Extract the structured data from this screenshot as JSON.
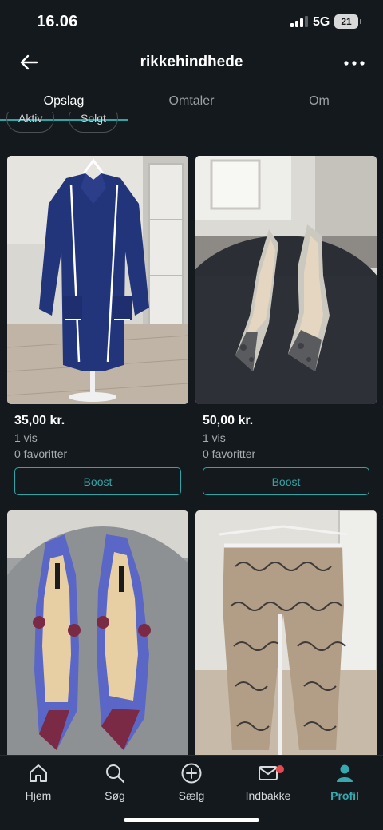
{
  "status_bar": {
    "time": "16.06",
    "network": "5G",
    "battery": "21"
  },
  "header": {
    "title": "rikkehindhede",
    "back_icon": "arrow-left-icon",
    "more_icon": "more-horizontal-icon"
  },
  "tabs": [
    {
      "label": "Opslag",
      "active": true
    },
    {
      "label": "Omtaler",
      "active": false
    },
    {
      "label": "Om",
      "active": false
    }
  ],
  "filters": [
    {
      "label": "Aktiv"
    },
    {
      "label": "Solgt"
    }
  ],
  "items": [
    {
      "price": "35,00 kr.",
      "views": "1 vis",
      "favorites": "0 favoritter",
      "boost_label": "Boost",
      "image": "blue-robe-photo"
    },
    {
      "price": "50,00 kr.",
      "views": "1 vis",
      "favorites": "0 favoritter",
      "boost_label": "Boost",
      "image": "snakeskin-heels-photo"
    },
    {
      "image": "floral-heels-photo"
    },
    {
      "image": "lace-pants-photo"
    }
  ],
  "bottom_nav": [
    {
      "label": "Hjem",
      "icon": "home-icon",
      "active": false
    },
    {
      "label": "Søg",
      "icon": "search-icon",
      "active": false
    },
    {
      "label": "Sælg",
      "icon": "plus-circle-icon",
      "active": false
    },
    {
      "label": "Indbakke",
      "icon": "mail-icon",
      "active": false,
      "badge": true
    },
    {
      "label": "Profil",
      "icon": "profile-icon",
      "active": true
    }
  ],
  "colors": {
    "background": "#14191d",
    "accent": "#2fa5a8",
    "badge": "#e5484d"
  }
}
